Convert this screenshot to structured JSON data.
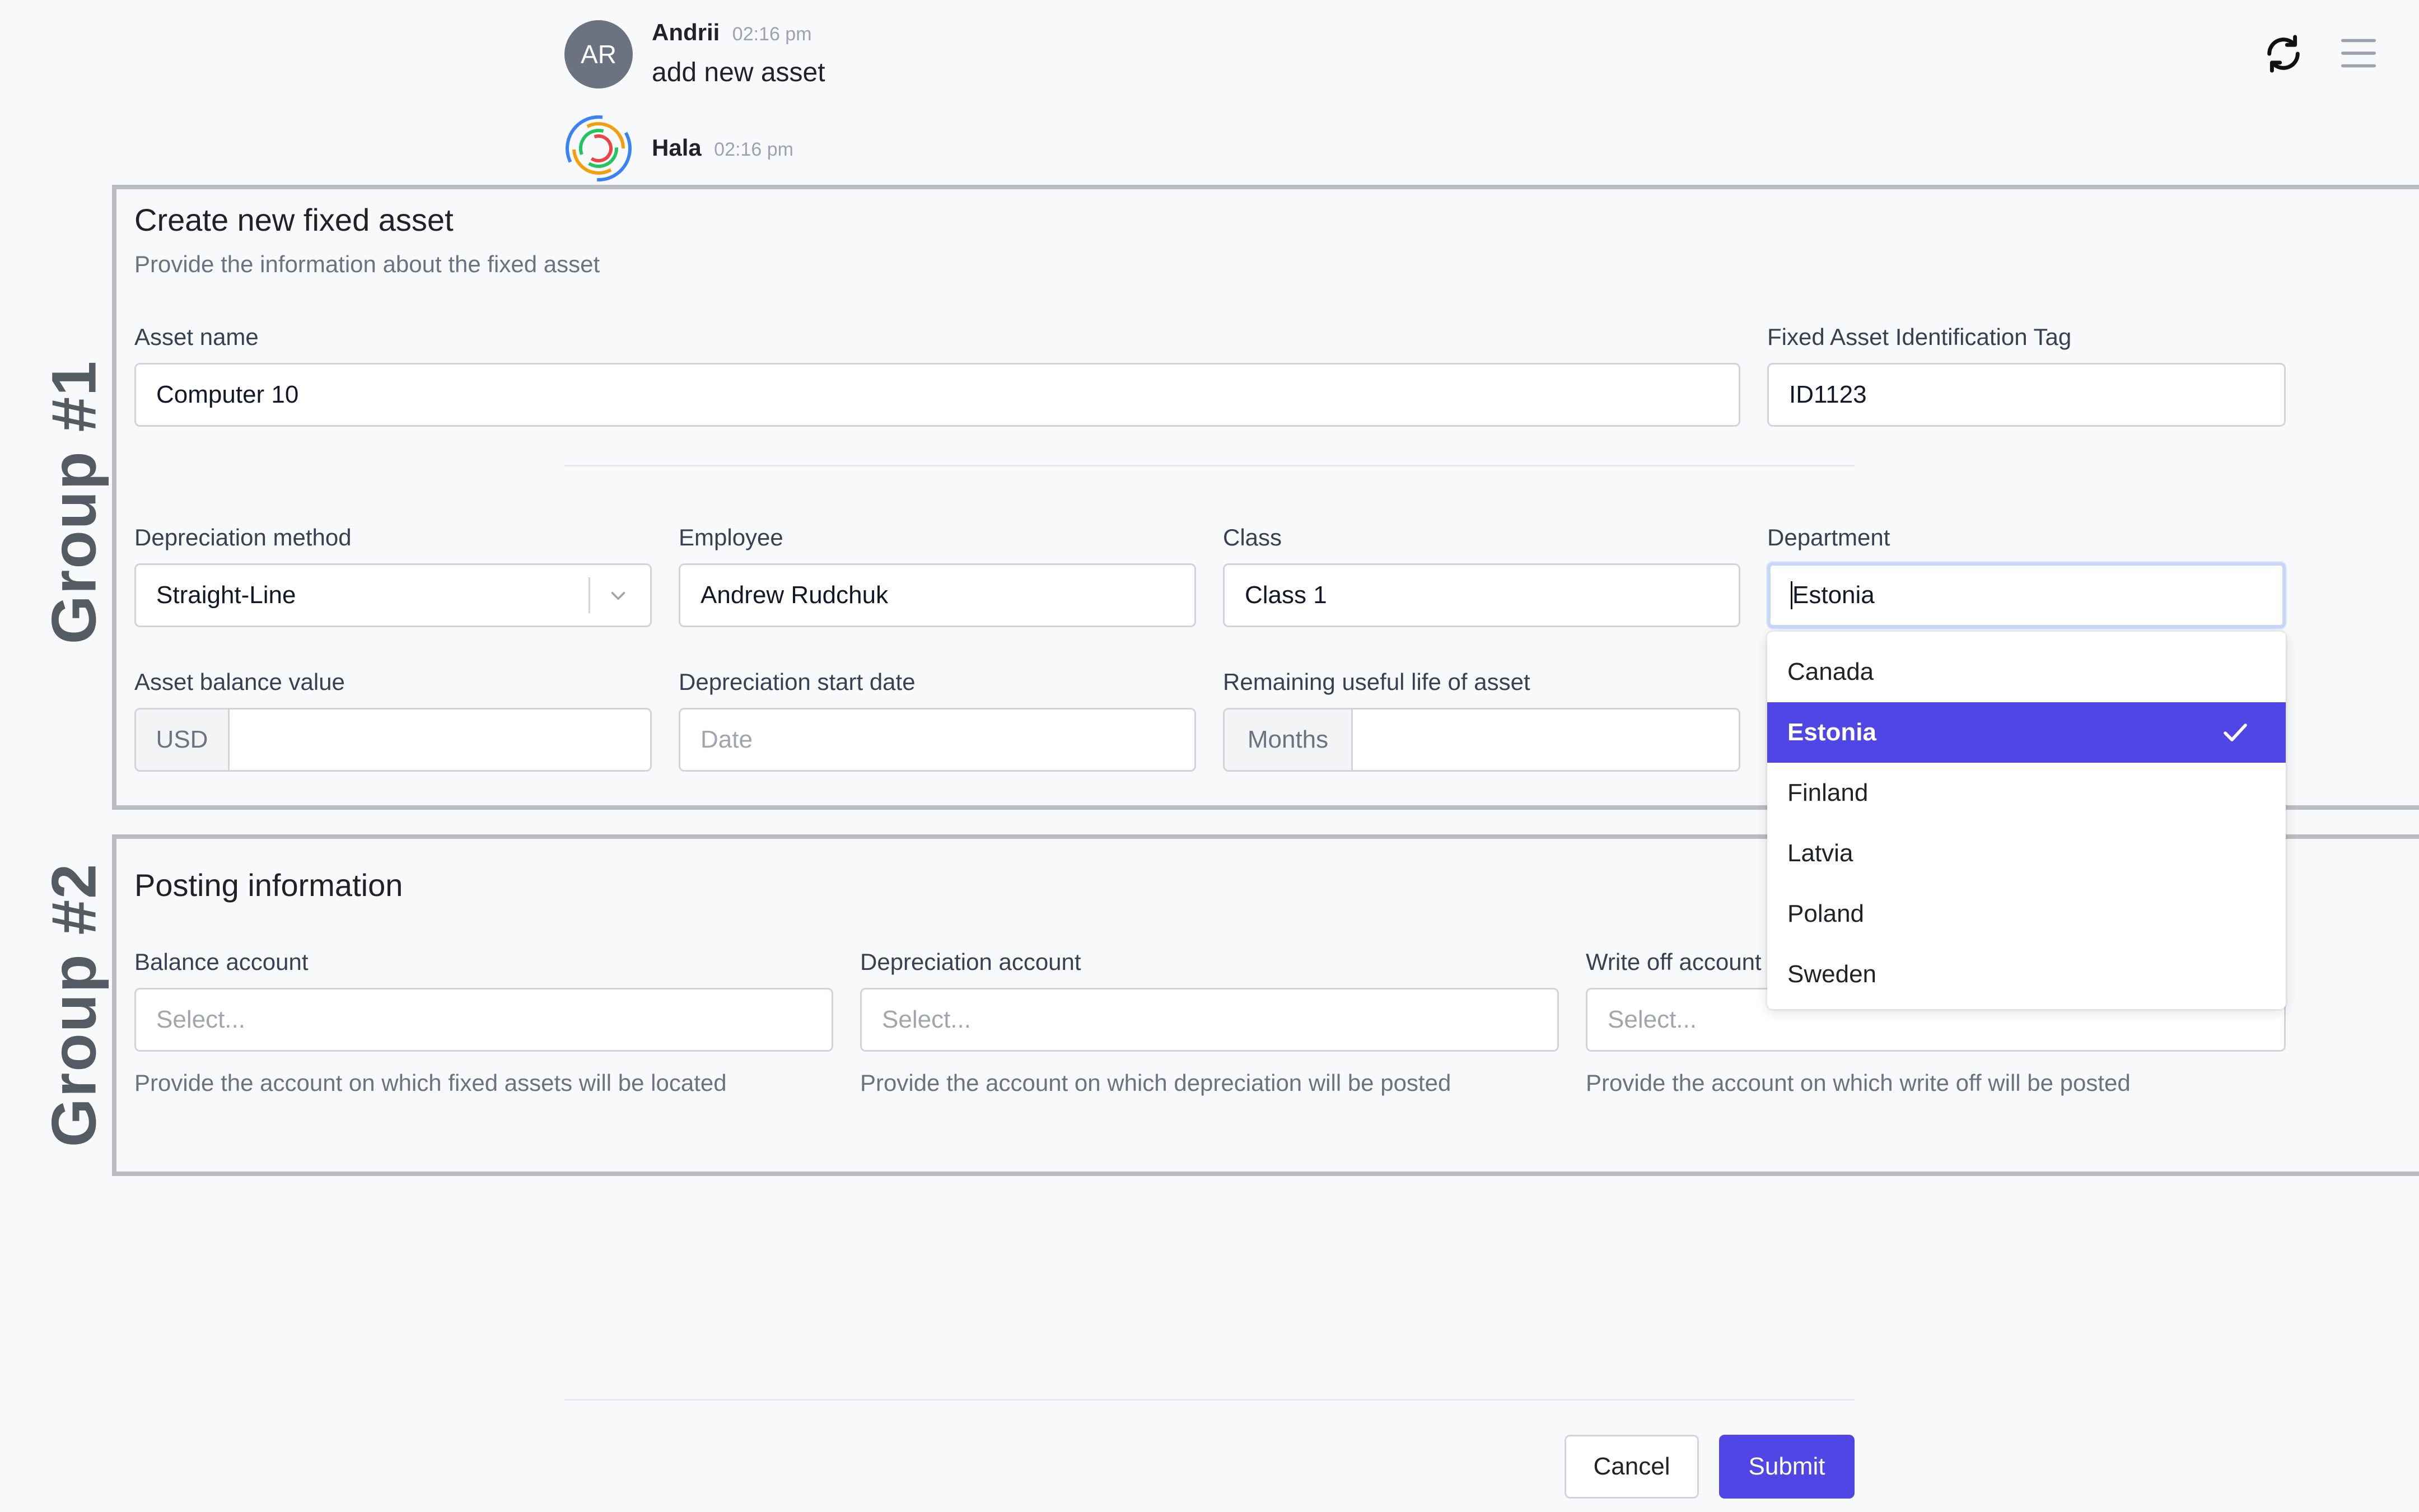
{
  "chat": {
    "user": {
      "initials": "AR",
      "name": "Andrii",
      "time": "02:16 pm",
      "message": "add new asset"
    },
    "bot": {
      "name": "Hala",
      "time": "02:16 pm"
    }
  },
  "toolbar": {
    "refresh_icon": "refresh-icon",
    "menu_icon": "menu-icon"
  },
  "groups": {
    "group1_label": "Group #1",
    "group2_label": "Group #2"
  },
  "form": {
    "title": "Create new fixed asset",
    "subtitle": "Provide the information about the fixed asset",
    "asset_name": {
      "label": "Asset name",
      "value": "Computer 10"
    },
    "asset_tag": {
      "label": "Fixed Asset Identification Tag",
      "value": "ID1123"
    },
    "depreciation_method": {
      "label": "Depreciation method",
      "value": "Straight-Line"
    },
    "employee": {
      "label": "Employee",
      "value": "Andrew Rudchuk"
    },
    "class": {
      "label": "Class",
      "value": "Class 1"
    },
    "department": {
      "label": "Department",
      "value": "Estonia"
    },
    "asset_balance": {
      "label": "Asset balance value",
      "addon": "USD",
      "value": ""
    },
    "depreciation_start": {
      "label": "Depreciation start date",
      "placeholder": "Date"
    },
    "remaining_life": {
      "label": "Remaining useful life of asset",
      "addon": "Months",
      "value": ""
    }
  },
  "department_dropdown": {
    "options": [
      "Canada",
      "Estonia",
      "Finland",
      "Latvia",
      "Poland",
      "Sweden"
    ],
    "selected": "Estonia"
  },
  "posting": {
    "title": "Posting information",
    "balance_account": {
      "label": "Balance account",
      "placeholder": "Select...",
      "help": "Provide the account on which fixed assets will be located"
    },
    "depreciation_account": {
      "label": "Depreciation account",
      "placeholder": "Select...",
      "help": "Provide the account on which depreciation will be posted"
    },
    "writeoff_account": {
      "label": "Write off account",
      "placeholder": "Select...",
      "help": "Provide the account on which write off will be posted"
    }
  },
  "actions": {
    "cancel": "Cancel",
    "submit": "Submit"
  },
  "colors": {
    "accent": "#4f46e5",
    "group_border": "#b9bcc0"
  }
}
